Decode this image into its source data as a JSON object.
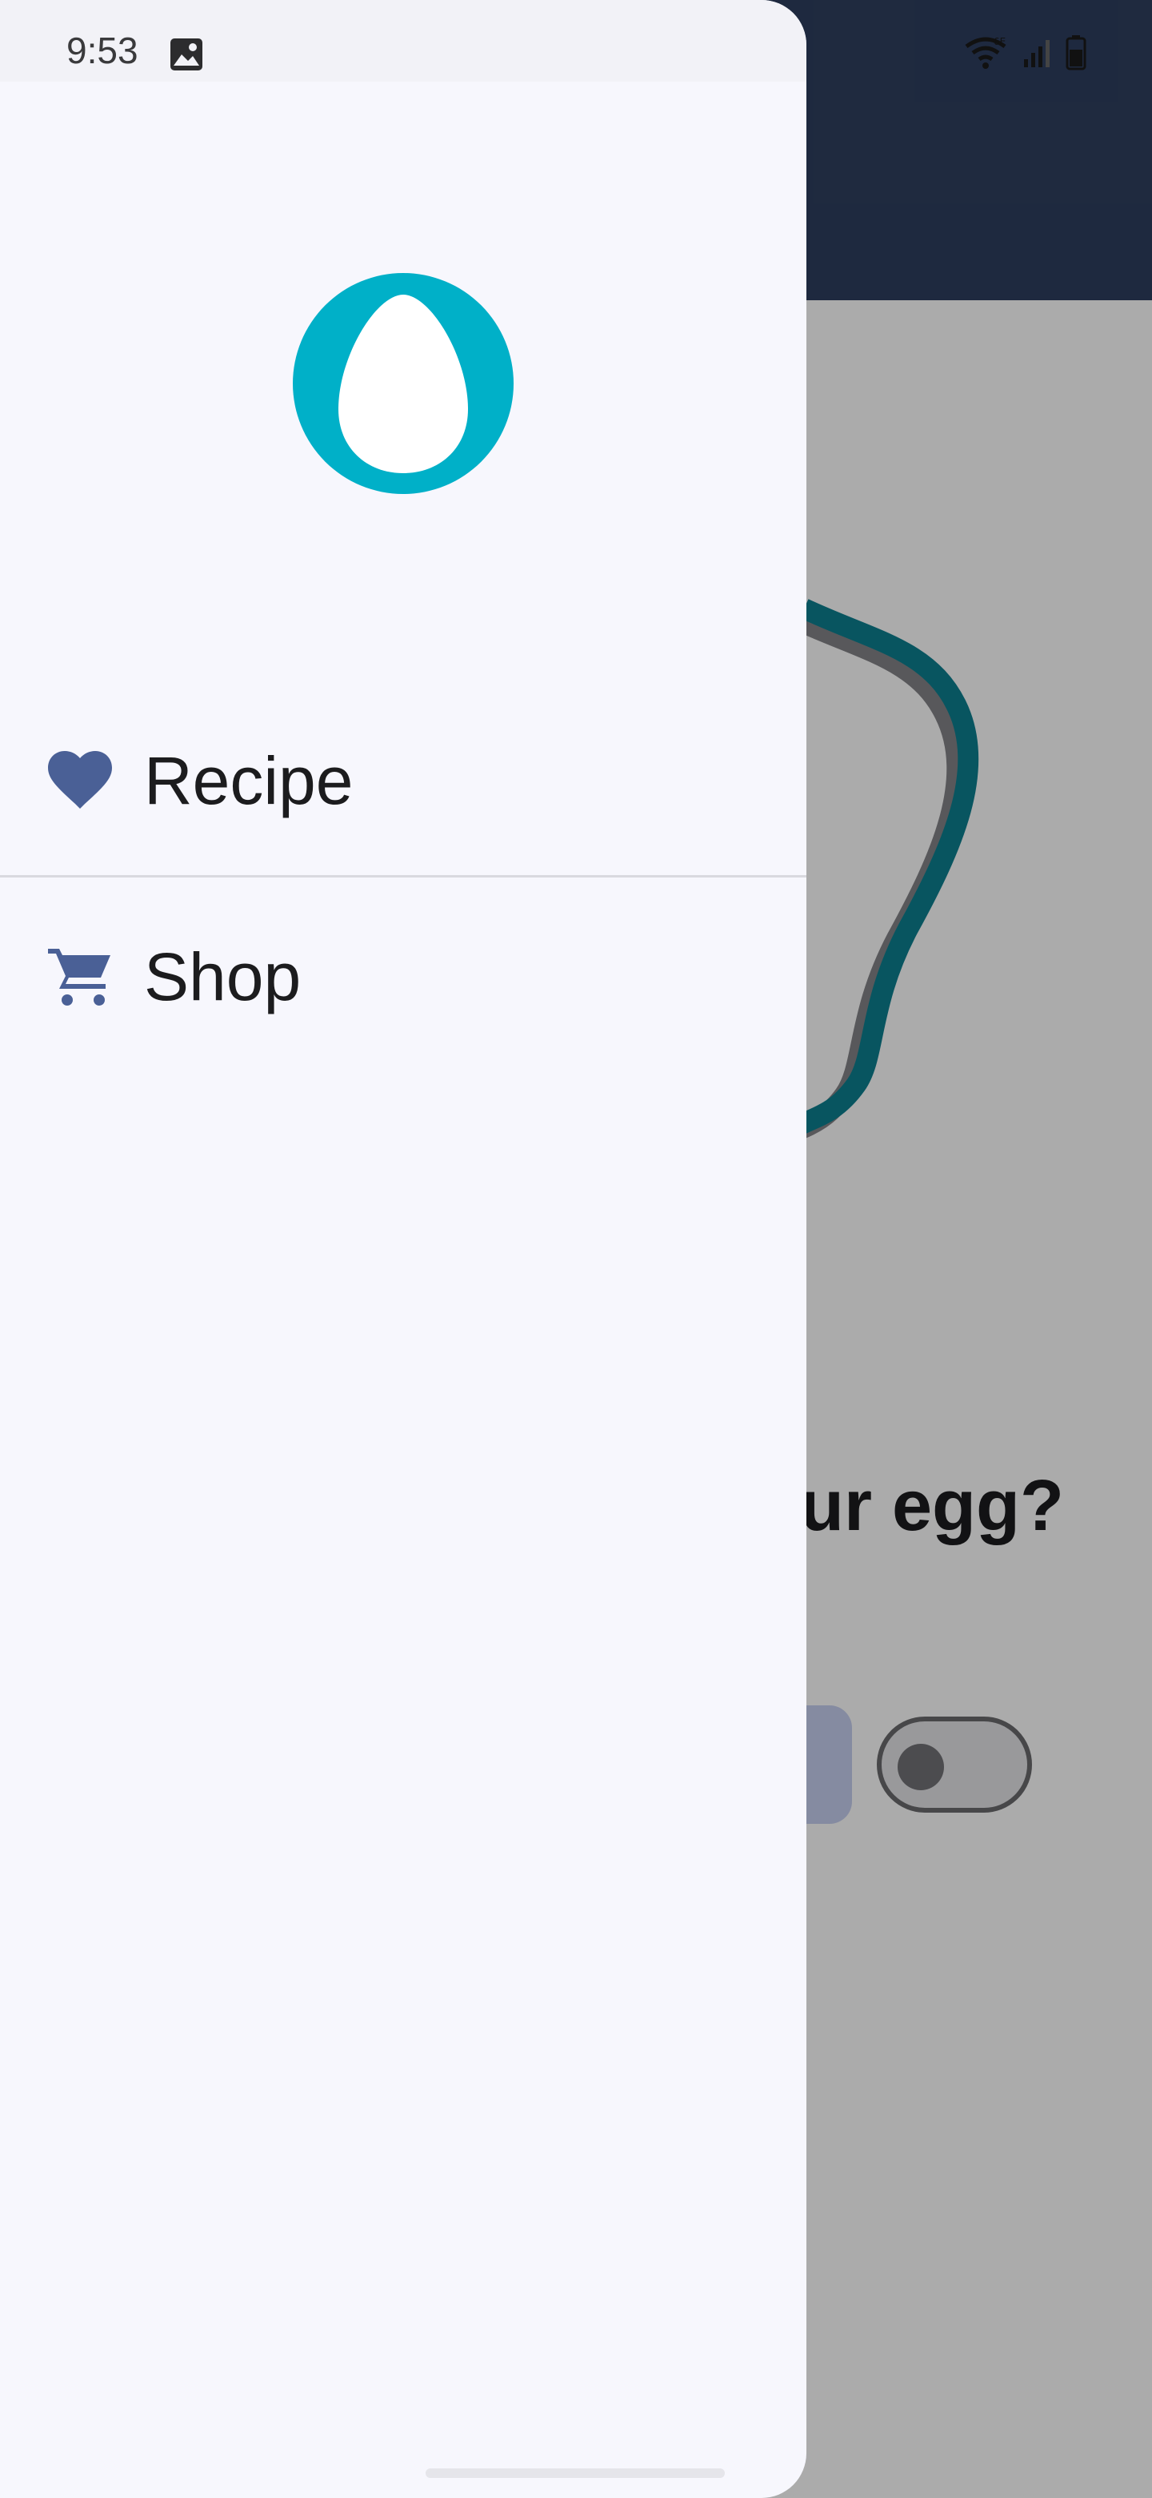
{
  "status_bar": {
    "time": "9:53",
    "icons": [
      "gallery-icon",
      "wifi-6e-icon",
      "cellular-signal-icon",
      "battery-icon"
    ]
  },
  "app_background": {
    "question_text": "ur egg?",
    "toggle_state": "off",
    "colors": {
      "topbar": "#2e3e5e",
      "accent": "#0d7f8f"
    }
  },
  "drawer": {
    "logo": "egg-logo-icon",
    "items": [
      {
        "label": "Recipe",
        "icon": "heart-icon"
      },
      {
        "label": "Shop",
        "icon": "cart-icon"
      }
    ],
    "colors": {
      "icon": "#4a6096",
      "logo_ring": "#00b0c8",
      "background": "#f7f7fd"
    }
  }
}
